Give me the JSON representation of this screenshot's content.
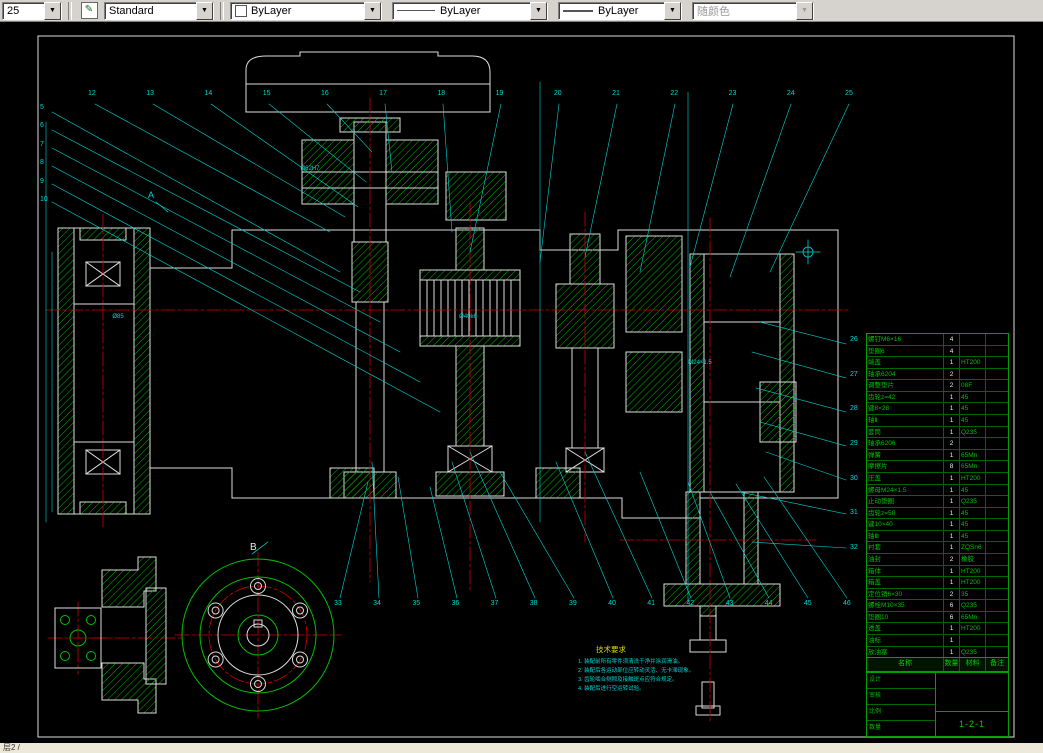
{
  "toolbar": {
    "dim_style_value": "25",
    "text_style_value": "Standard",
    "color_value": "ByLayer",
    "linetype_value": "ByLayer",
    "lineweight_value": "ByLayer",
    "plot_style_value": "随颜色"
  },
  "statusbar": {
    "text": "层2 /"
  },
  "drawing": {
    "view_b_label": "B",
    "view_a_label": "A",
    "notes_title": "技术要求",
    "notes": [
      "1. 装配前所有零件须清洗干净并涂润滑油。",
      "2. 装配后各运动部位应转动灵活、无卡滞现象。",
      "3. 齿轮啮合侧隙及接触斑点应符合规定。",
      "4. 装配后进行空运转试验。"
    ],
    "dim_labels": [
      "Ø62H7",
      "Ø40k6",
      "M24×1.5",
      "Ø85"
    ],
    "balloons_top": [
      "12",
      "13",
      "14",
      "15",
      "16",
      "17",
      "18",
      "19",
      "20",
      "21",
      "22",
      "23",
      "24",
      "25"
    ],
    "balloons_bottom": [
      "33",
      "34",
      "35",
      "36",
      "37",
      "38",
      "39",
      "40",
      "41",
      "42",
      "43",
      "44",
      "45",
      "46"
    ],
    "balloons_right": [
      "26",
      "27",
      "28",
      "29",
      "30",
      "31",
      "32"
    ],
    "balloons_left": [
      "5",
      "6",
      "7",
      "8",
      "9",
      "10"
    ]
  },
  "parts_table": {
    "headers": [
      "名称",
      "数量",
      "材料",
      "备注"
    ],
    "rows": [
      {
        "name": "螺钉M6×16",
        "qty": "4",
        "mat": "",
        "note": ""
      },
      {
        "name": "垫圈6",
        "qty": "4",
        "mat": "",
        "note": ""
      },
      {
        "name": "端盖",
        "qty": "1",
        "mat": "HT200",
        "note": ""
      },
      {
        "name": "轴承6204",
        "qty": "2",
        "mat": "",
        "note": ""
      },
      {
        "name": "调整垫片",
        "qty": "2",
        "mat": "08F",
        "note": ""
      },
      {
        "name": "齿轮z=42",
        "qty": "1",
        "mat": "45",
        "note": ""
      },
      {
        "name": "键8×28",
        "qty": "1",
        "mat": "45",
        "note": ""
      },
      {
        "name": "轴Ⅱ",
        "qty": "1",
        "mat": "45",
        "note": ""
      },
      {
        "name": "套筒",
        "qty": "1",
        "mat": "Q235",
        "note": ""
      },
      {
        "name": "轴承6206",
        "qty": "2",
        "mat": "",
        "note": ""
      },
      {
        "name": "弹簧",
        "qty": "1",
        "mat": "65Mn",
        "note": ""
      },
      {
        "name": "摩擦片",
        "qty": "8",
        "mat": "65Mn",
        "note": ""
      },
      {
        "name": "压盖",
        "qty": "1",
        "mat": "HT200",
        "note": ""
      },
      {
        "name": "螺母M24×1.5",
        "qty": "1",
        "mat": "45",
        "note": ""
      },
      {
        "name": "止动垫圈",
        "qty": "1",
        "mat": "Q235",
        "note": ""
      },
      {
        "name": "齿轮z=58",
        "qty": "1",
        "mat": "45",
        "note": ""
      },
      {
        "name": "键10×40",
        "qty": "1",
        "mat": "45",
        "note": ""
      },
      {
        "name": "轴Ⅲ",
        "qty": "1",
        "mat": "45",
        "note": ""
      },
      {
        "name": "衬套",
        "qty": "1",
        "mat": "ZQSn6",
        "note": ""
      },
      {
        "name": "油封",
        "qty": "2",
        "mat": "橡胶",
        "note": ""
      },
      {
        "name": "箱体",
        "qty": "1",
        "mat": "HT200",
        "note": ""
      },
      {
        "name": "箱盖",
        "qty": "1",
        "mat": "HT200",
        "note": ""
      },
      {
        "name": "定位销6×30",
        "qty": "2",
        "mat": "35",
        "note": ""
      },
      {
        "name": "螺栓M10×35",
        "qty": "6",
        "mat": "Q235",
        "note": ""
      },
      {
        "name": "垫圈10",
        "qty": "6",
        "mat": "65Mn",
        "note": ""
      },
      {
        "name": "透盖",
        "qty": "1",
        "mat": "HT200",
        "note": ""
      },
      {
        "name": "油标",
        "qty": "1",
        "mat": "",
        "note": ""
      },
      {
        "name": "放油塞",
        "qty": "1",
        "mat": "Q235",
        "note": ""
      }
    ]
  },
  "title_block": {
    "drawing_number": "1-2-1",
    "labels": [
      "设计",
      "审核",
      "比例",
      "数量"
    ]
  }
}
